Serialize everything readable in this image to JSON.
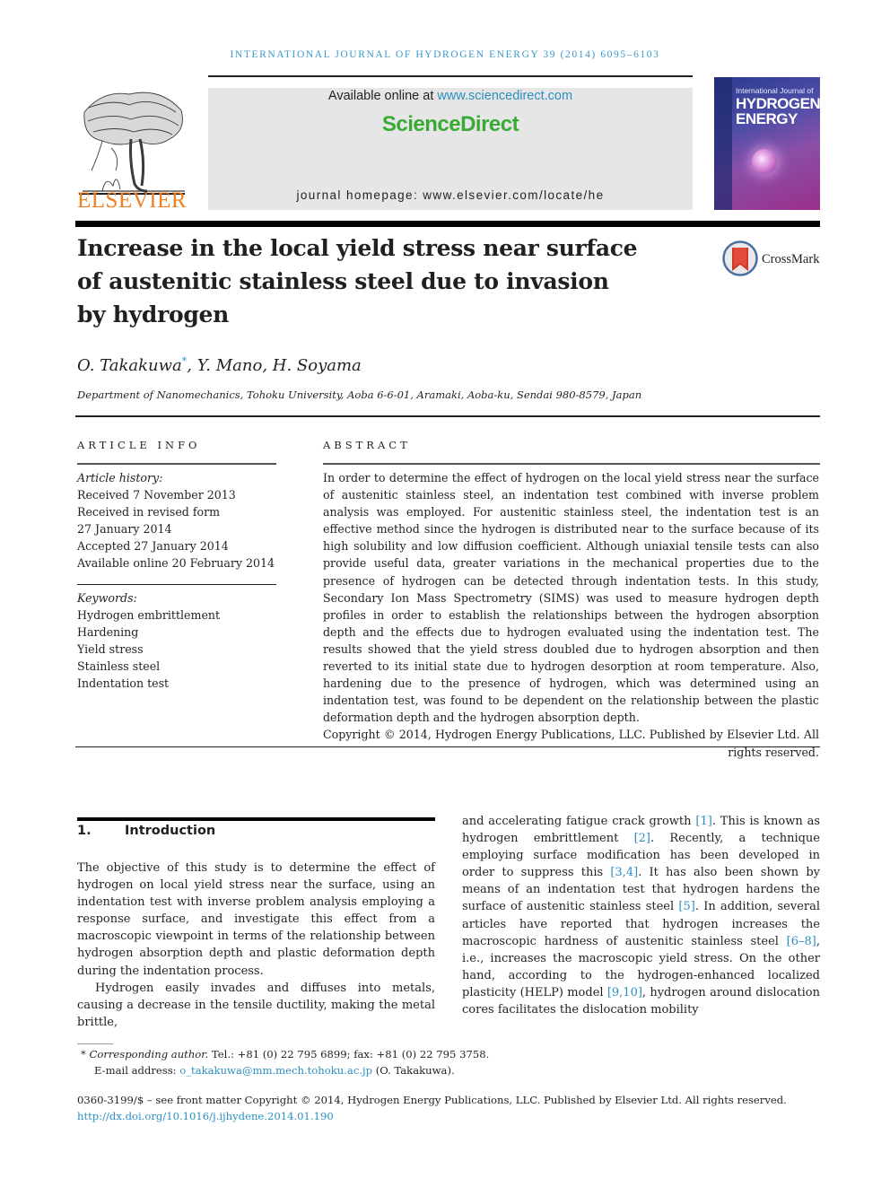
{
  "journal": {
    "running_head": "INTERNATIONAL JOURNAL OF HYDROGEN ENERGY 39 (2014) 6095–6103",
    "publisher_logo_text": "ELSEVIER",
    "available_online_prefix": "Available online at ",
    "available_online_link": "www.sciencedirect.com",
    "sciencedirect_brand": "ScienceDirect",
    "homepage_label": "journal homepage: ",
    "homepage_url": "www.elsevier.com/locate/he",
    "cover": {
      "line1": "International Journal of",
      "line2": "HYDROGEN",
      "line3": "ENERGY"
    },
    "colors": {
      "link": "#2c8fc1",
      "sciencedirect_green": "#3aaa35",
      "elsevier_orange": "#f07f1f",
      "banner_gray": "#e6e6e6"
    }
  },
  "article": {
    "title_lines": [
      "Increase in the local yield stress near surface",
      "of austenitic stainless steel due to invasion",
      "by hydrogen"
    ],
    "crossmark_label": "CrossMark",
    "authors": [
      {
        "name": "O. Takakuwa",
        "marker": "*"
      },
      {
        "name": "Y. Mano",
        "marker": ""
      },
      {
        "name": "H. Soyama",
        "marker": ""
      }
    ],
    "author_sep": ", ",
    "affiliation": "Department of Nanomechanics, Tohoku University, Aoba 6-6-01, Aramaki, Aoba-ku, Sendai 980-8579, Japan"
  },
  "article_info": {
    "heading": "ARTICLE INFO",
    "history_label": "Article history:",
    "history": [
      "Received 7 November 2013",
      "Received in revised form",
      "27 January 2014",
      "Accepted 27 January 2014",
      "Available online 20 February 2014"
    ],
    "keywords_label": "Keywords:",
    "keywords": [
      "Hydrogen embrittlement",
      "Hardening",
      "Yield stress",
      "Stainless steel",
      "Indentation test"
    ]
  },
  "abstract": {
    "heading": "ABSTRACT",
    "text": "In order to determine the effect of hydrogen on the local yield stress near the surface of austenitic stainless steel, an indentation test combined with inverse problem analysis was employed. For austenitic stainless steel, the indentation test is an effective method since the hydrogen is distributed near to the surface because of its high solubility and low diffusion coefficient. Although uniaxial tensile tests can also provide useful data, greater variations in the mechanical properties due to the presence of hydrogen can be detected through indentation tests. In this study, Secondary Ion Mass Spectrometry (SIMS) was used to measure hydrogen depth profiles in order to establish the relationships between the hydrogen absorption depth and the effects due to hydrogen evaluated using the indentation test. The results showed that the yield stress doubled due to hydrogen absorption and then reverted to its initial state due to hydrogen desorption at room temperature. Also, hardening due to the presence of hydrogen, which was determined using an indentation test, was found to be dependent on the relationship between the plastic deformation depth and the hydrogen absorption depth.",
    "copyright": "Copyright © 2014, Hydrogen Energy Publications, LLC. Published by Elsevier Ltd. All rights reserved."
  },
  "introduction": {
    "number": "1.",
    "heading": "Introduction",
    "para1": "The objective of this study is to determine the effect of hydrogen on local yield stress near the surface, using an indentation test with inverse problem analysis employing a response surface, and investigate this effect from a macroscopic viewpoint in terms of the relationship between hydrogen absorption depth and plastic deformation depth during the indentation process.",
    "para2_left": "Hydrogen easily invades and diffuses into metals, causing a decrease in the tensile ductility, making the metal brittle,",
    "right_segments": [
      {
        "t": "and accelerating fatigue crack growth "
      },
      {
        "t": "[1]",
        "ref": true
      },
      {
        "t": ". This is known as hydrogen embrittlement "
      },
      {
        "t": "[2]",
        "ref": true
      },
      {
        "t": ". Recently, a technique employing surface modification has been developed in order to suppress this "
      },
      {
        "t": "[3,4]",
        "ref": true
      },
      {
        "t": ". It has also been shown by means of an indentation test that hydrogen hardens the surface of austenitic stainless steel "
      },
      {
        "t": "[5]",
        "ref": true
      },
      {
        "t": ". In addition, several articles have reported that hydrogen increases the macroscopic hardness of austenitic stainless steel "
      },
      {
        "t": "[6–8]",
        "ref": true
      },
      {
        "t": ", i.e., increases the macroscopic yield stress. On the other hand, according to the hydrogen-enhanced localized plasticity (HELP) model "
      },
      {
        "t": "[9,10]",
        "ref": true
      },
      {
        "t": ", hydrogen around dislocation cores facilitates the dislocation mobility"
      }
    ]
  },
  "footnote": {
    "marker": "*",
    "corresponding_label": "Corresponding author.",
    "contact": " Tel.: +81 (0) 22 795 6899; fax: +81 (0) 22 795 3758.",
    "email_label": "E-mail address: ",
    "email": "o_takakuwa@mm.mech.tohoku.ac.jp",
    "email_suffix": " (O. Takakuwa)."
  },
  "front_matter": {
    "issn_line": "0360-3199/$ – see front matter Copyright © 2014, Hydrogen Energy Publications, LLC. Published by Elsevier Ltd. All rights reserved.",
    "doi": "http://dx.doi.org/10.1016/j.ijhydene.2014.01.190"
  }
}
